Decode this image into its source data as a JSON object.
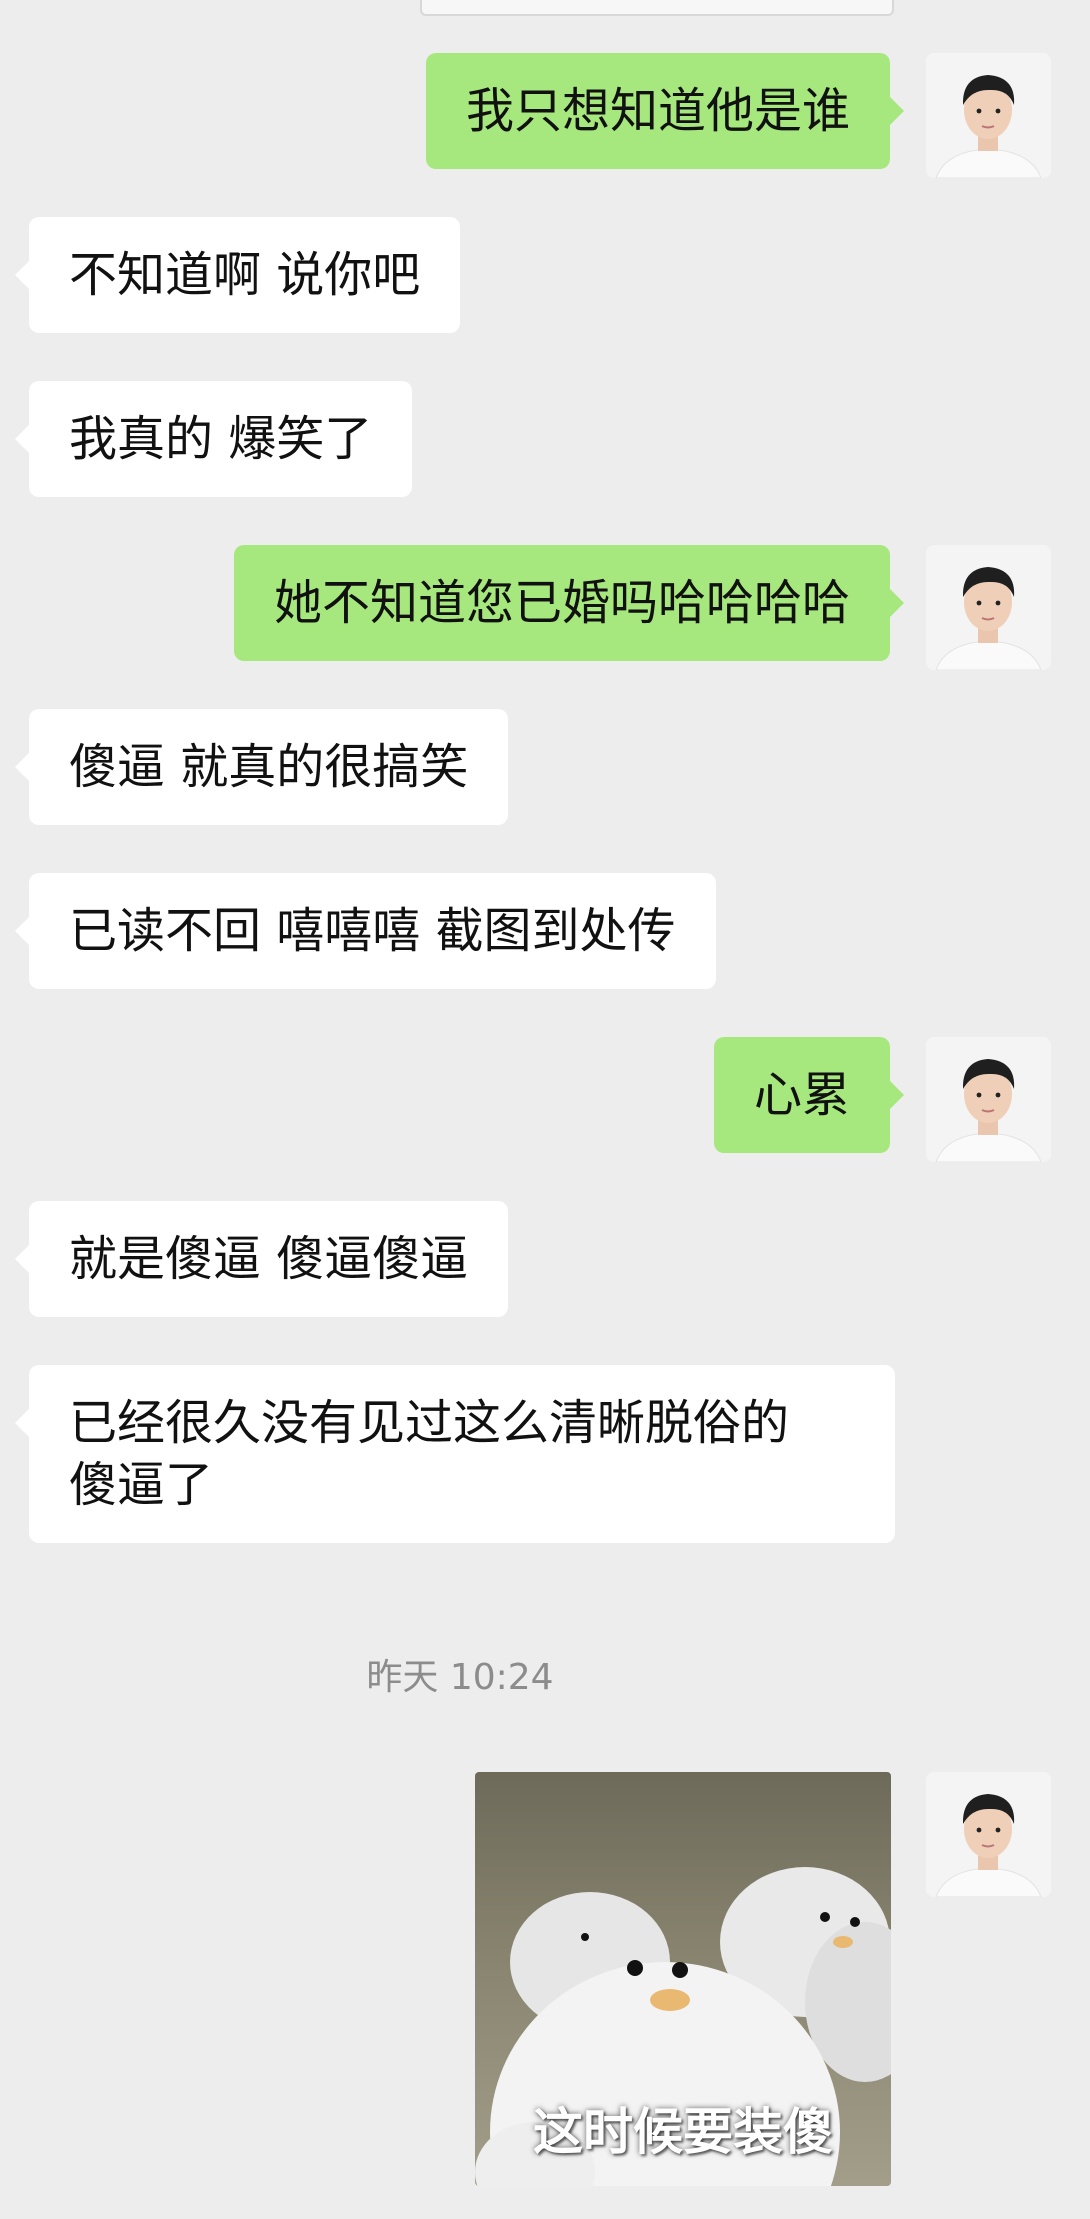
{
  "messages": [
    {
      "side": "out",
      "text": "我只想知道他是谁"
    },
    {
      "side": "in",
      "text": "不知道啊 说你吧"
    },
    {
      "side": "in",
      "text": "我真的 爆笑了"
    },
    {
      "side": "out",
      "text": "她不知道您已婚吗哈哈哈哈"
    },
    {
      "side": "in",
      "text": "傻逼 就真的很搞笑"
    },
    {
      "side": "in",
      "text": "已读不回 嘻嘻嘻 截图到处传"
    },
    {
      "side": "out",
      "text": "心累"
    },
    {
      "side": "in",
      "text": "就是傻逼 傻逼傻逼"
    },
    {
      "side": "in",
      "text": "已经很久没有见过这么清晰脱俗的\n傻逼了"
    }
  ],
  "timestamp": "昨天 10:24",
  "sticker": {
    "caption": "这时候要装傻"
  },
  "colors": {
    "outgoing_bubble": "#a6e87d",
    "incoming_bubble": "#ffffff",
    "background": "#ededed"
  }
}
